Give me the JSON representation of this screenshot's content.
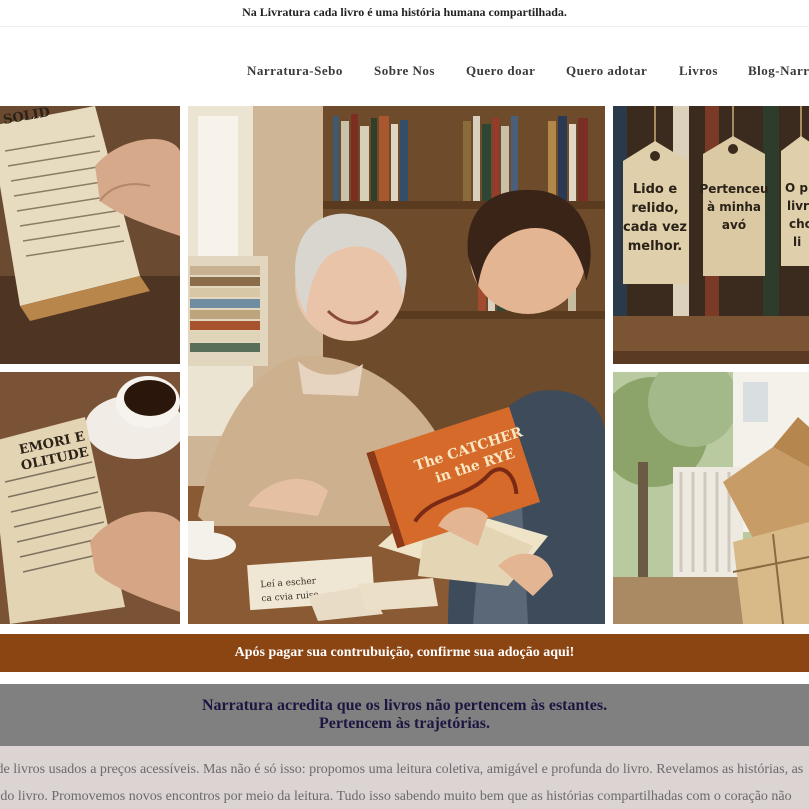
{
  "topbar": {
    "text": "Na Livratura cada livro é uma história humana compartilhada."
  },
  "nav": {
    "items": [
      {
        "label": "Narratura-Sebo"
      },
      {
        "label": "Sobre Nos"
      },
      {
        "label": "Quero doar"
      },
      {
        "label": "Quero adotar"
      },
      {
        "label": "Livros"
      },
      {
        "label": "Blog-Narr"
      }
    ]
  },
  "photos": {
    "book_cover": [
      "The CATCHER",
      "in the RYE"
    ],
    "tag_right_1": [
      "Lido e",
      "relido,",
      "cada vez",
      "melhor."
    ],
    "tag_right_2": [
      "Pertenceu",
      "à minha",
      "avó"
    ],
    "tag_right_3": [
      "O pri",
      "livro",
      "cho",
      "li"
    ],
    "page_left_top": "SOLID",
    "page_left_bottom": [
      "EMORI E",
      "OLITUDE"
    ],
    "table_tag": [
      "Leí a escher",
      "ca cvia ruise"
    ]
  },
  "cta": {
    "text": "Após pagar sua contrubuição, confirme sua adoção aqui!"
  },
  "tagline": {
    "line1": "Narratura acredita que os livros não pertencem às estantes.",
    "line2": "Pertencem às trajetórias."
  },
  "intro": {
    "line1": "o de livros usados a preços acessíveis. Mas não é só isso: propomos uma leitura coletiva, amigável e profunda do livro. Revelamos as histórias, as",
    "line2": "io do livro. Promovemos novos encontros por meio da leitura. Tudo isso sabendo muito bem que as histórias compartilhadas com o coração não"
  },
  "colors": {
    "cta_bg": "#8b4513",
    "tagline_bg": "#808080",
    "tagline_text": "#1c1540",
    "intro_bg": "#dcd3d3"
  }
}
